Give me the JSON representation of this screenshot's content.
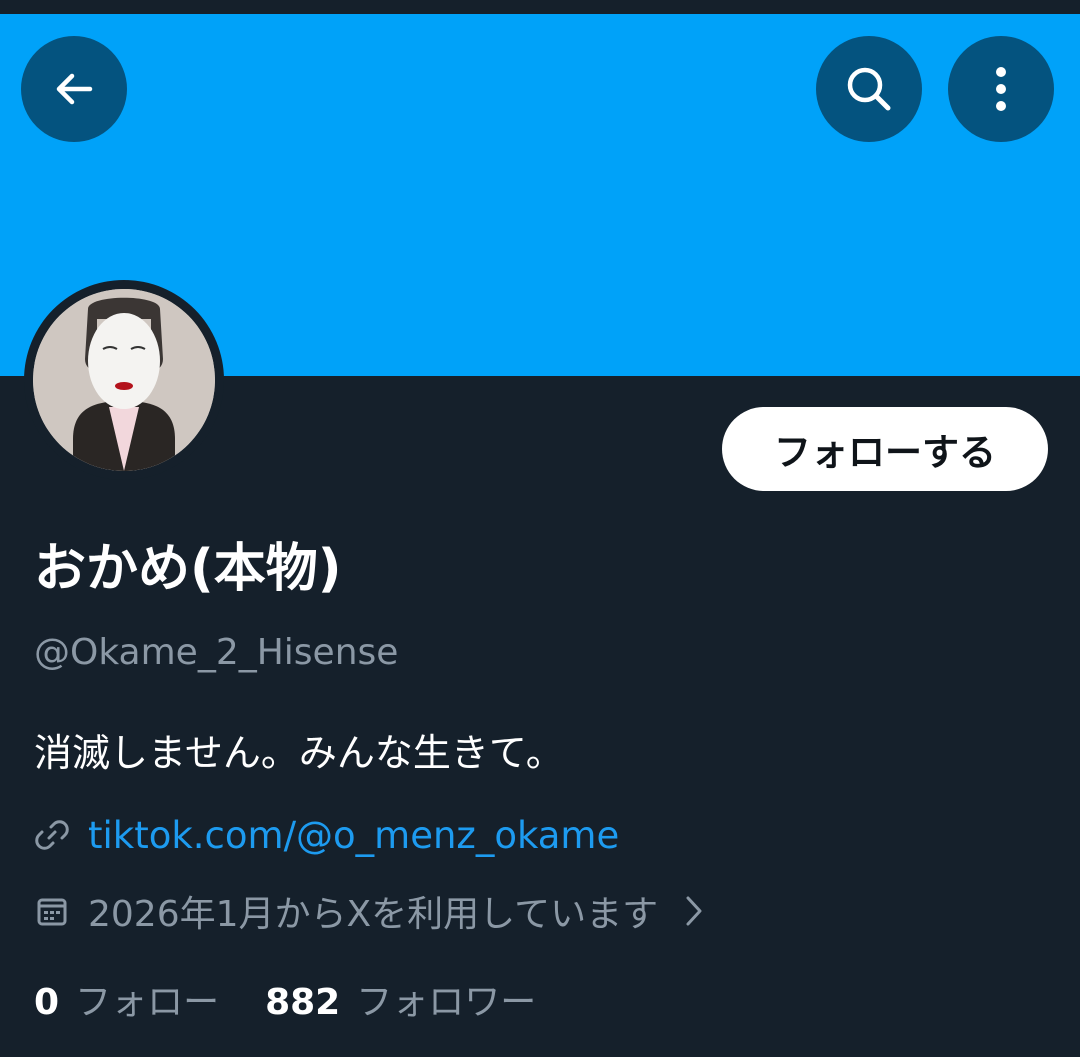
{
  "colors": {
    "banner": "#00a2f9",
    "background": "#15202b",
    "accent_link": "#1d9bf0",
    "secondary_text": "#8b98a5"
  },
  "header": {
    "back_icon": "arrow-left-icon",
    "search_icon": "search-icon",
    "more_icon": "more-vertical-icon"
  },
  "profile": {
    "display_name": "おかめ(本物)",
    "handle": "@Okame_2_Hisense",
    "bio": "消滅しません。みんな生きて。",
    "link": "tiktok.com/@o_menz_okame",
    "joined": "2026年1月からXを利用しています",
    "follow_button": "フォローする"
  },
  "stats": {
    "following_count": "0",
    "following_label": "フォロー",
    "followers_count": "882",
    "followers_label": "フォロワー"
  }
}
